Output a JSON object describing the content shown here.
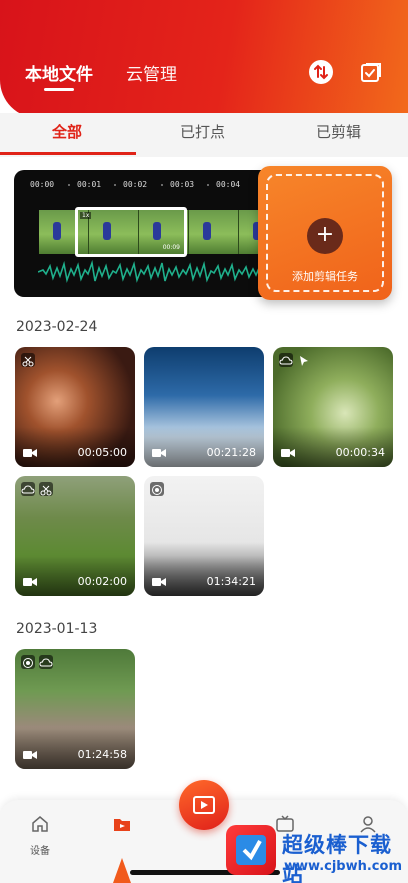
{
  "header": {
    "tabs": [
      {
        "label": "本地文件",
        "active": true
      },
      {
        "label": "云管理",
        "active": false
      }
    ],
    "icons": [
      "sort-icon",
      "checklist-icon"
    ],
    "accent": "#e02318"
  },
  "filters": {
    "tabs": [
      "全部",
      "已打点",
      "已剪辑"
    ],
    "selected": "全部"
  },
  "editor": {
    "ticks": [
      "00:00",
      "00:01",
      "00:02",
      "00:03",
      "00:04"
    ],
    "selection_badge": "1x",
    "selection_time": "00:09"
  },
  "add_task": {
    "label": "添加剪辑任务",
    "icon": "plus-icon"
  },
  "groups": [
    {
      "date": "2023-02-24",
      "items": [
        {
          "duration": "00:05:00",
          "badges": [
            "scissors-icon"
          ],
          "subject": "basketball"
        },
        {
          "duration": "00:21:28",
          "badges": [],
          "subject": "ice-hockey"
        },
        {
          "duration": "00:00:34",
          "badges": [
            "cloud-icon",
            "pointer-icon"
          ],
          "subject": "badminton"
        },
        {
          "duration": "00:02:00",
          "badges": [
            "cloud-icon",
            "scissors-icon"
          ],
          "subject": "soccer"
        },
        {
          "duration": "01:34:21",
          "badges": [
            "record-icon"
          ],
          "subject": "yoga"
        }
      ]
    },
    {
      "date": "2023-01-13",
      "items": [
        {
          "duration": "01:24:58",
          "badges": [
            "record-icon",
            "cloud-icon"
          ],
          "subject": "street-basketball"
        }
      ]
    }
  ],
  "bottom_nav": {
    "items": [
      {
        "label": "设备",
        "icon": "home-icon"
      },
      {
        "label": "",
        "icon": "folder-video-icon",
        "active": true
      },
      {
        "label": "",
        "icon": "record-video-icon",
        "center": true
      },
      {
        "label": "",
        "icon": "tv-icon"
      },
      {
        "label": "",
        "icon": "profile-icon"
      }
    ]
  },
  "watermark": {
    "title": "超级棒下载站",
    "url": "www.cjbwh.com"
  }
}
